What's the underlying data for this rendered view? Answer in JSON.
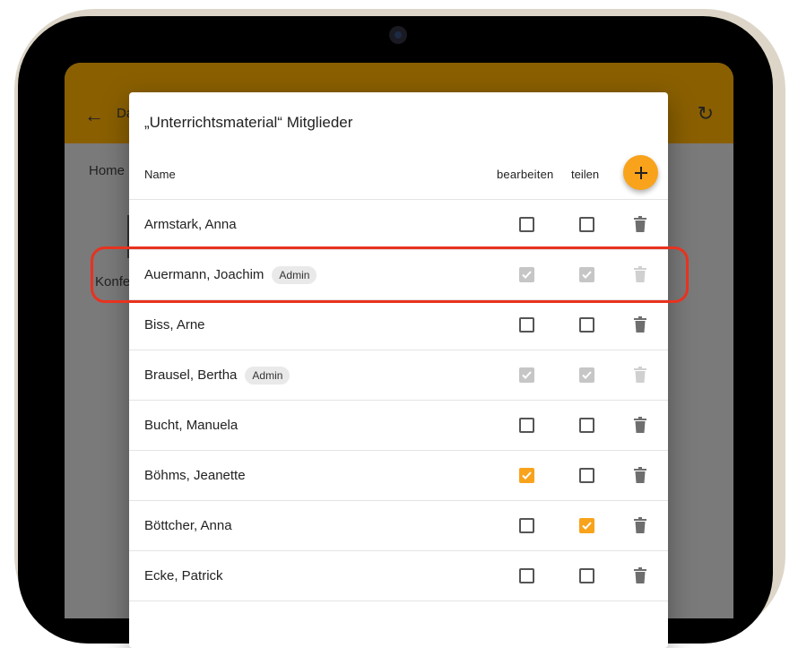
{
  "app": {
    "title_fragment": "Da",
    "breadcrumb_home": "Home",
    "background_item_fragment": "Konfe",
    "back_icon": "arrow-left-icon",
    "reload_icon": "refresh-icon"
  },
  "dialog": {
    "title": "„Unterrichtsmaterial“ Mitglieder",
    "columns": {
      "name": "Name",
      "edit": "bearbeiten",
      "share": "teilen"
    },
    "add_icon": "plus-icon",
    "delete_icon": "trash-icon",
    "accent_color": "#f8a31b",
    "members": [
      {
        "name": "Armstark, Anna",
        "badge": "",
        "edit": false,
        "share": false,
        "locked": false
      },
      {
        "name": "Auermann, Joachim",
        "badge": "Admin",
        "edit": true,
        "share": true,
        "locked": true
      },
      {
        "name": "Biss, Arne",
        "badge": "",
        "edit": false,
        "share": false,
        "locked": false
      },
      {
        "name": "Brausel, Bertha",
        "badge": "Admin",
        "edit": true,
        "share": true,
        "locked": true
      },
      {
        "name": "Bucht, Manuela",
        "badge": "",
        "edit": false,
        "share": false,
        "locked": false
      },
      {
        "name": "Böhms, Jeanette",
        "badge": "",
        "edit": true,
        "share": false,
        "locked": false
      },
      {
        "name": "Böttcher, Anna",
        "badge": "",
        "edit": false,
        "share": true,
        "locked": false
      },
      {
        "name": "Ecke, Patrick",
        "badge": "",
        "edit": false,
        "share": false,
        "locked": false
      }
    ]
  },
  "annotation": {
    "highlight_color": "#e8321f",
    "highlighted_member_index": 1
  }
}
